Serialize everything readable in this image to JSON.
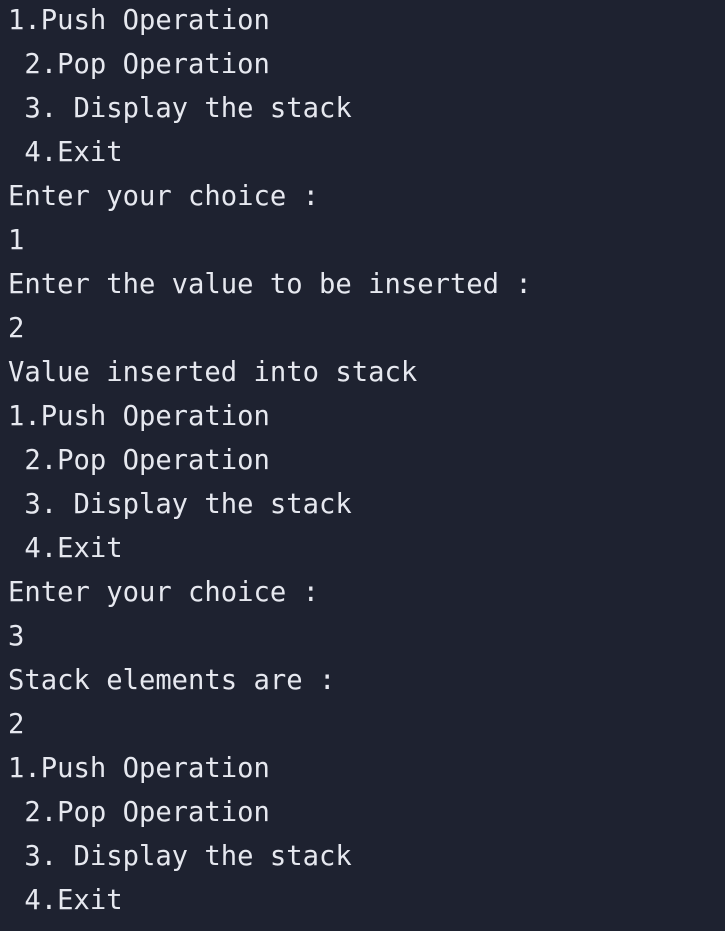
{
  "terminal": {
    "lines": [
      "1.Push Operation",
      " 2.Pop Operation",
      " 3. Display the stack",
      " 4.Exit",
      "Enter your choice :",
      "1",
      "Enter the value to be inserted :",
      "2",
      "Value inserted into stack",
      "1.Push Operation",
      " 2.Pop Operation",
      " 3. Display the stack",
      " 4.Exit",
      "Enter your choice :",
      "3",
      "Stack elements are :",
      "2",
      "1.Push Operation",
      " 2.Pop Operation",
      " 3. Display the stack",
      " 4.Exit"
    ]
  },
  "colors": {
    "background": "#1e2230",
    "text": "#e6e8ef"
  }
}
